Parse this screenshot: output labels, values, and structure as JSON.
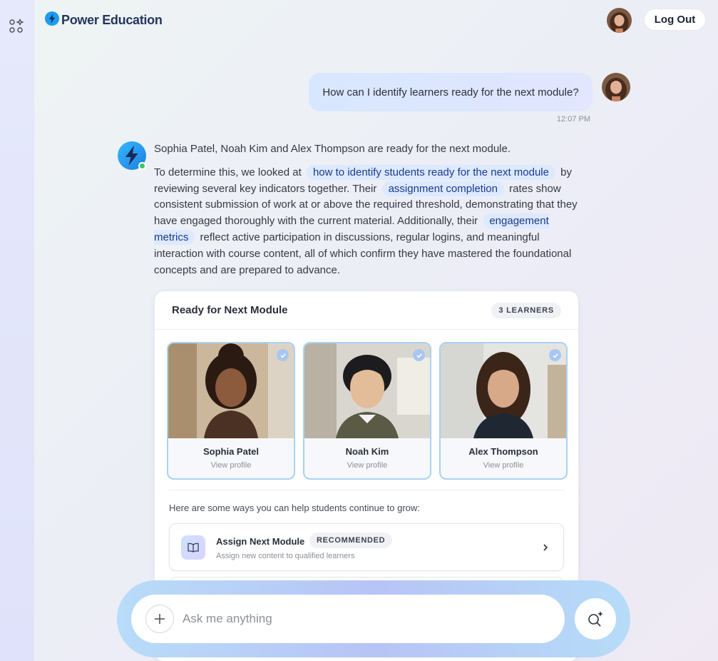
{
  "app": {
    "brand": "Power Education",
    "logout_label": "Log Out"
  },
  "conversation": {
    "user_message": "How can I identify learners ready for the next module?",
    "user_timestamp": "12:07 PM",
    "answer": {
      "summary": "Sophia Patel, Noah Kim and Alex Thompson are ready for the next module.",
      "p2_a": "To determine this, we looked at",
      "chip1": "how to identify students ready for the next module",
      "p2_b": "by reviewing several key indicators together. Their",
      "chip2": "assignment completion",
      "p2_c": "rates show consistent submission of work at or above the required threshold, demonstrating that they have engaged thoroughly with the current material. Additionally, their",
      "chip3": "engagement metrics",
      "p2_d": "reflect active participation in discussions, regular logins, and meaningful interaction with course content, all of which confirm they have mastered the foundational concepts and are prepared to advance."
    }
  },
  "card": {
    "title": "Ready for Next Module",
    "count_badge": "3 LEARNERS",
    "learners": [
      {
        "name": "Sophia Patel",
        "link": "View profile"
      },
      {
        "name": "Noah Kim",
        "link": "View profile"
      },
      {
        "name": "Alex Thompson",
        "link": "View profile"
      }
    ],
    "ways_text": "Here are some ways you can help students continue to grow:",
    "actions": [
      {
        "title": "Assign Next Module",
        "badge": "RECOMMENDED",
        "subtitle": "Assign new content to qualified learners"
      }
    ]
  },
  "composer": {
    "placeholder": "Ask me anything"
  },
  "colors": {
    "accent": "#1d9bf0",
    "chip_bg": "#dde9ff",
    "online": "#3cc55a"
  },
  "icons": [
    "apps-icon",
    "bolt-logo-icon",
    "check-icon",
    "book-icon",
    "chevron-right-icon",
    "plus-icon",
    "search-sparkle-icon"
  ]
}
